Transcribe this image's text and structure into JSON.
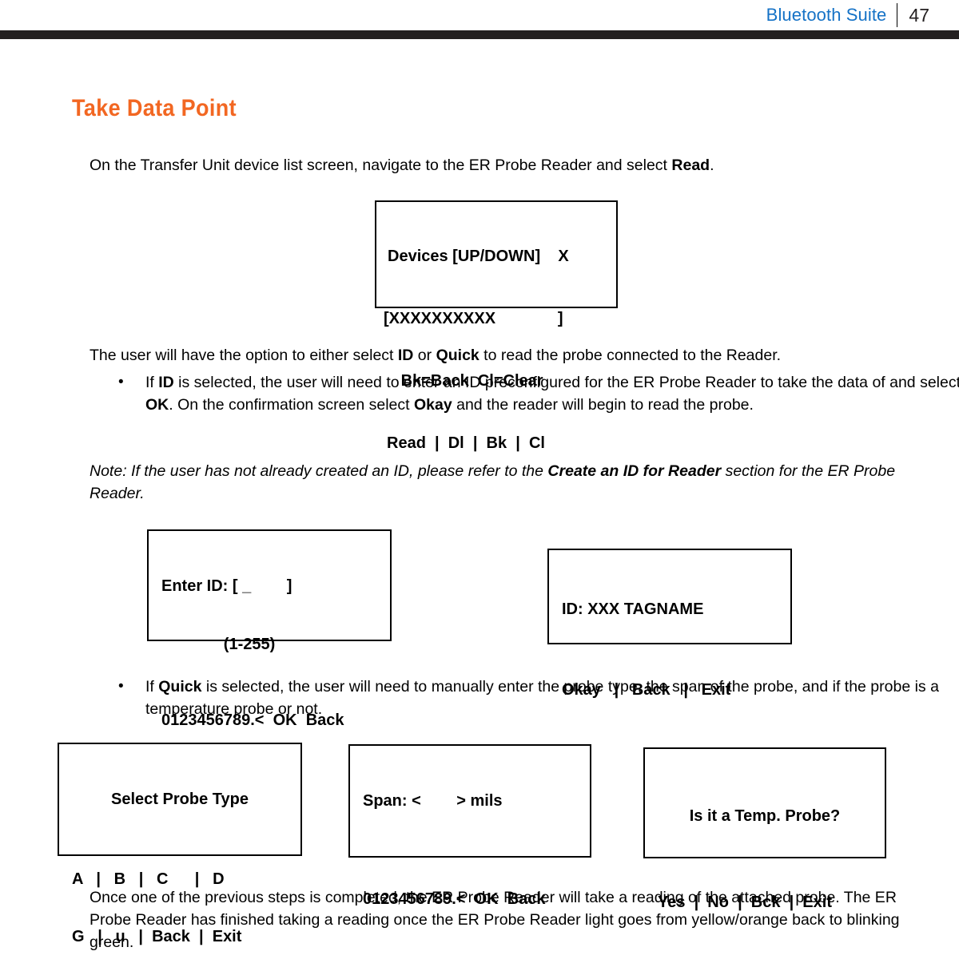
{
  "header": {
    "title": "Bluetooth Suite",
    "page_number": "47",
    "title_color": "#1572c6",
    "rule_color": "#231f20"
  },
  "section": {
    "title": "Take Data Point",
    "title_color": "#f26722"
  },
  "paragraphs": {
    "intro_pre": "On the Transfer Unit device list screen, navigate to the ER Probe Reader and select ",
    "intro_bold": "Read",
    "intro_post": ".",
    "option_pre": "The user will have the option to either select ",
    "option_bold1": "ID",
    "option_mid": " or ",
    "option_bold2": "Quick",
    "option_post": " to read the probe connected to the Reader.",
    "note_pre": "Note: If the user has not already created an ID, please refer to the ",
    "note_bold": "Create an ID for Reader",
    "note_post": " section for the ER Probe Reader.",
    "final": "Once one of the previous steps is completed, the ER Probe Reader will take a reading of the attached probe. The ER Probe Reader has finished taking a reading once the ER Probe Reader light goes from yellow/orange back to blinking green."
  },
  "bullets": {
    "marker": "•",
    "id_pre": "If ",
    "id_bold1": "ID",
    "id_mid1": " is selected, the user will need to enter an ID preconfigured for the ER Probe Reader to take the data of and select ",
    "id_bold2": "OK",
    "id_mid2": ". On the confirmation screen select ",
    "id_bold3": "Okay",
    "id_post": " and the reader will begin to read the probe.",
    "quick_pre": "If ",
    "quick_bold": "Quick",
    "quick_post": " is selected, the user will need to manually enter the probe type, the span of the probe, and if the probe is a temperature probe or not."
  },
  "screens": {
    "devices": {
      "line1": "Devices [UP/DOWN]    X",
      "line2": "[XXXXXXXXXX              ]",
      "line3": "   Bk=Back  Cl=Clear",
      "line4": "Read  |  Dl  |  Bk  |  Cl"
    },
    "enter_id": {
      "line1": "Enter ID: [ _        ]",
      "line2": "              (1-255)",
      "line3": "0123456789.<  OK  Back"
    },
    "confirm_id": {
      "line1": "ID: XXX TAGNAME",
      "line2": "Okay   |   Back   |   Exit"
    },
    "probe_type": {
      "line1": "Select Probe Type",
      "line2": "A   |   B   |   C      |   D",
      "line3": "G   |   u   |  Back  |  Exit"
    },
    "span": {
      "line1": "Span: <        > mils",
      "line2": "0123456789.<  OK  Back"
    },
    "temp_probe": {
      "line1": "Is it a Temp. Probe?",
      "line2": "Yes  |  No  |  Bck  |  Exit"
    }
  }
}
